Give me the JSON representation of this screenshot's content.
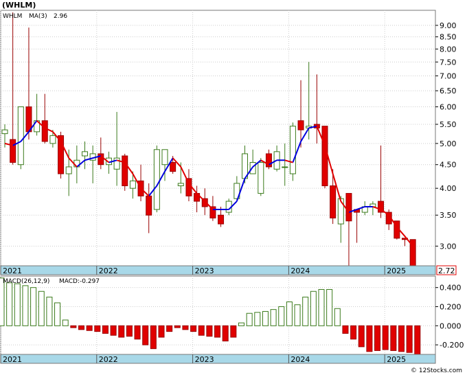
{
  "header": {
    "title": "(WHLM)"
  },
  "footer": {
    "copyright": "© 12Stocks.com"
  },
  "colors": {
    "up": "#3a7a1a",
    "down": "#e00000",
    "ma": "#0000dd",
    "axis_band": "#a8d8e8"
  },
  "chart_data": [
    {
      "type": "candlestick",
      "legend": {
        "symbol": "WHLM",
        "ma_label": "MA(3)",
        "ma_value": "2.96"
      },
      "last_price_label": "2.72",
      "y_scale": "log",
      "ylim": [
        2.72,
        9.7
      ],
      "y_ticks": [
        "9.00",
        "8.50",
        "8.00",
        "7.50",
        "7.00",
        "6.50",
        "6.00",
        "5.50",
        "5.00",
        "4.50",
        "4.00",
        "3.50",
        "3.00"
      ],
      "x_labels": [
        {
          "label": "2021",
          "x": 0
        },
        {
          "label": "2022",
          "x": 12
        },
        {
          "label": "2023",
          "x": 24
        },
        {
          "label": "2024",
          "x": 36
        },
        {
          "label": "2025",
          "x": 48
        }
      ],
      "candles": [
        [
          5.25,
          5.35,
          4.9,
          5.5
        ],
        [
          5.1,
          4.55,
          4.5,
          9.6
        ],
        [
          4.5,
          6.0,
          4.4,
          6.0
        ],
        [
          6.0,
          5.3,
          5.1,
          8.9
        ],
        [
          5.3,
          5.6,
          5.2,
          6.4
        ],
        [
          5.6,
          5.05,
          5.0,
          6.4
        ],
        [
          5.0,
          5.2,
          4.9,
          5.35
        ],
        [
          5.2,
          4.3,
          4.2,
          5.3
        ],
        [
          4.3,
          4.45,
          3.85,
          4.85
        ],
        [
          4.45,
          4.6,
          4.1,
          4.95
        ],
        [
          4.7,
          4.8,
          4.4,
          5.05
        ],
        [
          4.6,
          4.75,
          4.1,
          4.95
        ],
        [
          4.75,
          4.5,
          4.4,
          5.15
        ],
        [
          4.5,
          4.65,
          4.3,
          4.8
        ],
        [
          4.4,
          4.65,
          4.05,
          5.85
        ],
        [
          4.7,
          4.05,
          3.95,
          4.75
        ],
        [
          4.0,
          4.15,
          3.8,
          4.35
        ],
        [
          4.15,
          3.85,
          3.75,
          4.5
        ],
        [
          3.85,
          3.5,
          3.2,
          4.1
        ],
        [
          3.6,
          4.85,
          3.55,
          4.95
        ],
        [
          4.5,
          4.85,
          4.15,
          4.85
        ],
        [
          4.55,
          4.35,
          4.3,
          4.7
        ],
        [
          4.05,
          4.1,
          3.9,
          4.55
        ],
        [
          4.2,
          3.85,
          3.75,
          4.4
        ],
        [
          3.9,
          3.75,
          3.55,
          4.05
        ],
        [
          3.8,
          3.65,
          3.5,
          4.0
        ],
        [
          3.65,
          3.45,
          3.4,
          3.85
        ],
        [
          3.5,
          3.35,
          3.3,
          3.65
        ],
        [
          3.55,
          3.75,
          3.5,
          3.8
        ],
        [
          3.8,
          4.1,
          3.75,
          4.25
        ],
        [
          4.2,
          4.75,
          4.1,
          4.95
        ],
        [
          4.3,
          4.55,
          4.3,
          4.85
        ],
        [
          3.9,
          4.55,
          3.85,
          4.65
        ],
        [
          4.75,
          4.45,
          4.4,
          4.85
        ],
        [
          4.4,
          4.8,
          4.35,
          4.95
        ],
        [
          4.45,
          4.45,
          4.05,
          5.0
        ],
        [
          4.3,
          5.45,
          4.15,
          5.55
        ],
        [
          5.6,
          5.35,
          4.9,
          6.85
        ],
        [
          5.4,
          5.45,
          5.1,
          7.5
        ],
        [
          5.5,
          5.4,
          5.0,
          7.05
        ],
        [
          5.45,
          4.05,
          4.0,
          5.45
        ],
        [
          4.05,
          3.45,
          3.35,
          4.4
        ],
        [
          3.35,
          3.8,
          3.05,
          3.85
        ],
        [
          3.9,
          3.4,
          2.72,
          3.9
        ],
        [
          3.6,
          3.55,
          3.05,
          3.6
        ],
        [
          3.55,
          3.65,
          3.5,
          3.75
        ],
        [
          3.65,
          3.7,
          3.5,
          3.75
        ],
        [
          3.75,
          3.55,
          3.45,
          4.95
        ],
        [
          3.55,
          3.35,
          3.25,
          3.6
        ],
        [
          3.4,
          3.12,
          3.1,
          3.4
        ],
        [
          3.12,
          3.1,
          3.0,
          3.12
        ],
        [
          3.1,
          2.72,
          2.72,
          3.1
        ]
      ],
      "ma": [
        5.0,
        4.95,
        5.05,
        5.3,
        5.6,
        5.4,
        5.3,
        5.05,
        4.65,
        4.45,
        4.6,
        4.65,
        4.7,
        4.55,
        4.6,
        4.55,
        4.3,
        4.0,
        3.85,
        4.05,
        4.35,
        4.65,
        4.45,
        4.1,
        3.9,
        3.75,
        3.6,
        3.6,
        3.6,
        3.75,
        4.2,
        4.45,
        4.6,
        4.5,
        4.6,
        4.6,
        4.55,
        5.05,
        5.4,
        5.45,
        4.95,
        4.3,
        3.75,
        3.55,
        3.6,
        3.65,
        3.65,
        3.6,
        3.5,
        3.3,
        3.15,
        3.0
      ]
    },
    {
      "type": "bar",
      "legend": {
        "label": "MACD(26,12,9)",
        "value_label": "MACD:-0.297"
      },
      "ylim": [
        -0.3,
        0.52
      ],
      "y_ticks": [
        "0.400",
        "0.200",
        "0.000",
        "-0.200"
      ],
      "x_labels": [
        {
          "label": "2021",
          "x": 0
        },
        {
          "label": "2022",
          "x": 12
        },
        {
          "label": "2023",
          "x": 24
        },
        {
          "label": "2024",
          "x": 36
        },
        {
          "label": "2025",
          "x": 48
        }
      ],
      "values": [
        0.5,
        0.45,
        0.44,
        0.42,
        0.4,
        0.36,
        0.3,
        0.24,
        0.06,
        -0.02,
        -0.04,
        -0.05,
        -0.06,
        -0.08,
        -0.1,
        -0.12,
        -0.11,
        -0.14,
        -0.2,
        -0.24,
        -0.12,
        -0.06,
        -0.02,
        -0.04,
        -0.06,
        -0.1,
        -0.11,
        -0.12,
        -0.16,
        -0.12,
        0.03,
        0.13,
        0.14,
        0.15,
        0.17,
        0.2,
        0.25,
        0.22,
        0.3,
        0.36,
        0.38,
        0.38,
        0.18,
        -0.08,
        -0.14,
        -0.22,
        -0.27,
        -0.26,
        -0.25,
        -0.26,
        -0.27,
        -0.28,
        -0.3
      ]
    }
  ]
}
